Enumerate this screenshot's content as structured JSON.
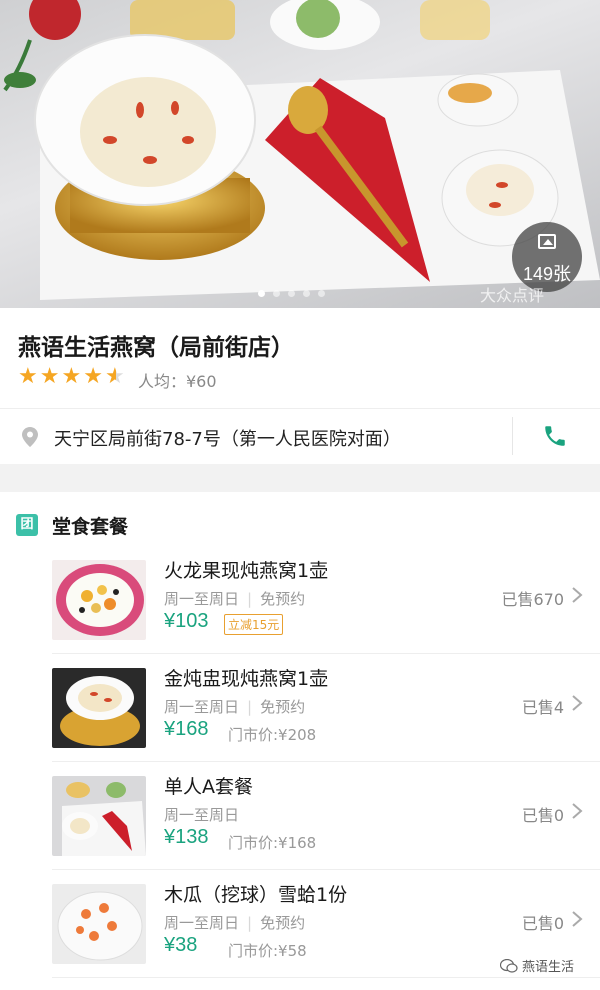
{
  "hero": {
    "photo_count": "149张",
    "watermark": "大众点评",
    "dots": 5,
    "active_dot": 0
  },
  "shop": {
    "name": "燕语生活燕窝（局前街店）",
    "rating_stars": 4.5,
    "avg_price": "人均：¥60",
    "address": "天宁区局前街78-7号（第一人民医院对面）",
    "star_color": "#f5a623",
    "phone_icon": "phone-icon",
    "location_icon": "map-pin-icon"
  },
  "deals": {
    "badge": "团",
    "title": "堂食套餐",
    "accent_color": "#1aa37f",
    "items": [
      {
        "name": "火龙果现炖燕窝1壶",
        "days": "周一至周日",
        "reservation": "免预约",
        "price": "¥103",
        "promo": "立减15元",
        "market_price": "",
        "sold": "已售670"
      },
      {
        "name": "金炖盅现炖燕窝1壶",
        "days": "周一至周日",
        "reservation": "免预约",
        "price": "¥168",
        "promo": "",
        "market_price": "门市价:¥208",
        "sold": "已售4"
      },
      {
        "name": "单人A套餐",
        "days": "周一至周日",
        "reservation": "",
        "price": "¥138",
        "promo": "",
        "market_price": "门市价:¥168",
        "sold": "已售0"
      },
      {
        "name": "木瓜（挖球）雪蛤1份",
        "days": "周一至周日",
        "reservation": "免预约",
        "price": "¥38",
        "promo": "",
        "market_price": "门市价:¥58",
        "sold": "已售0"
      }
    ]
  },
  "footer": {
    "account": "燕语生活"
  }
}
